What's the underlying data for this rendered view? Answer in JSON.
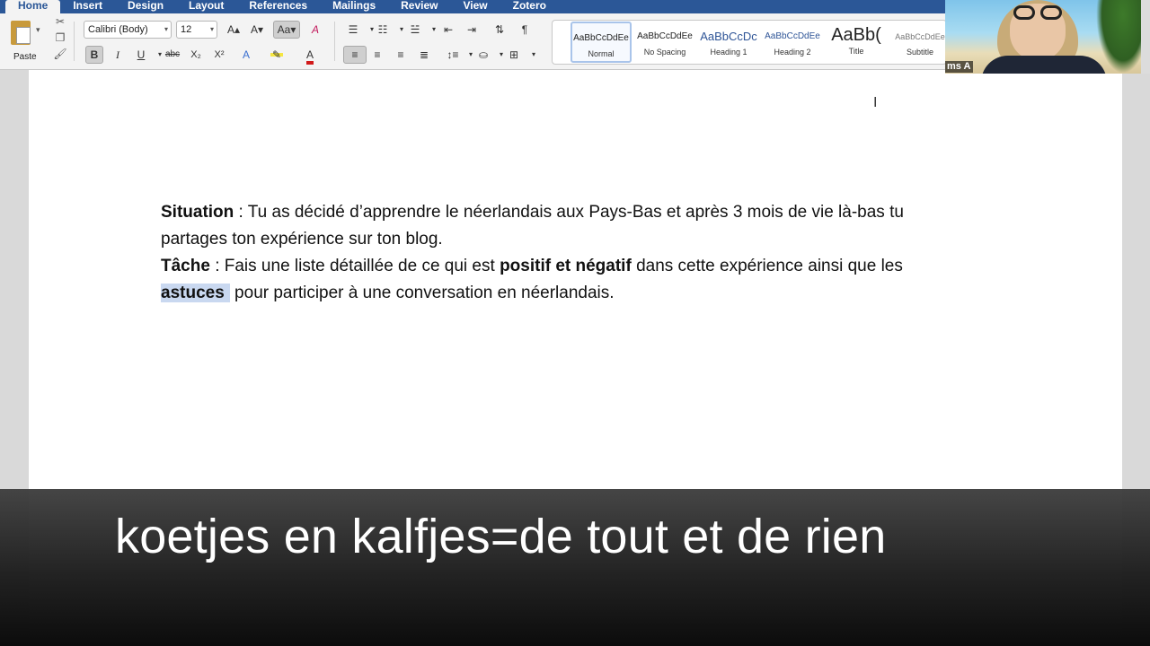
{
  "tabs": [
    {
      "label": "Home",
      "active": true
    },
    {
      "label": "Insert"
    },
    {
      "label": "Design"
    },
    {
      "label": "Layout"
    },
    {
      "label": "References"
    },
    {
      "label": "Mailings"
    },
    {
      "label": "Review"
    },
    {
      "label": "View"
    },
    {
      "label": "Zotero"
    }
  ],
  "clipboard": {
    "paste_label": "Paste",
    "cut_icon": "scissors-icon",
    "copy_icon": "copy-icon",
    "format_painter_icon": "brush-icon"
  },
  "font": {
    "name": "Calibri (Body)",
    "size": "12",
    "grow": "A▴",
    "shrink": "A▾",
    "change_case": "Aa",
    "clear_format": "A"
  },
  "format": {
    "bold": "B",
    "italic": "I",
    "underline": "U",
    "strike": "abc",
    "subscript": "X₂",
    "superscript": "X²",
    "text_effects": "A",
    "highlight_color": "#f5e642",
    "font_color": "#d11a1a",
    "font_color_label": "A"
  },
  "paragraph_tools": {
    "pilcrow": "¶"
  },
  "styles": [
    {
      "preview": "AaBbCcDdEe",
      "name": "Normal",
      "selected": true
    },
    {
      "preview": "AaBbCcDdEe",
      "name": "No Spacing"
    },
    {
      "preview": "AaBbCcDc",
      "name": "Heading 1"
    },
    {
      "preview": "AaBbCcDdEe",
      "name": "Heading 2"
    },
    {
      "preview": "AaBb(",
      "name": "Title"
    },
    {
      "preview": "AaBbCcDdEe",
      "name": "Subtitle"
    }
  ],
  "document": {
    "situation_label": "Situation",
    "situation_text": " : Tu as décidé d’apprendre le néerlandais aux Pays-Bas et après 3 mois de vie là-bas tu partages ton expérience sur ton blog.",
    "tache_label": "Tâche",
    "tache_text_1": " : Fais une liste détaillée de ce qui est ",
    "tache_bold_1": "positif et négatif",
    "tache_text_2": " dans cette expérience ainsi que les ",
    "tache_bold_2": "astuces",
    "tache_text_3": " pour participer à une conversation en néerlandais."
  },
  "webcam": {
    "name_label": "ms A"
  },
  "subtitle": {
    "text": "koetjes en kalfjes=de tout et de rien"
  },
  "colors": {
    "tab_bar": "#2b5797",
    "ribbon": "#f3f3f3",
    "selection_highlight": "#c9d8f0"
  }
}
